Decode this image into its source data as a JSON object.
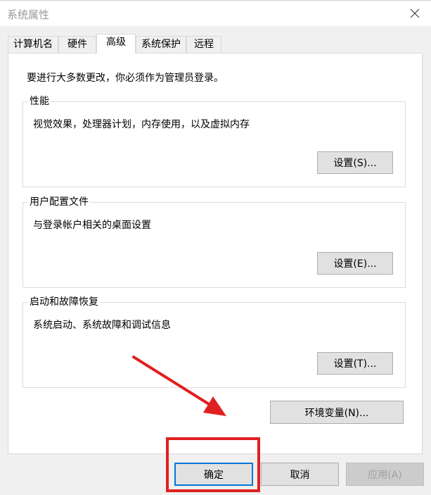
{
  "window": {
    "title": "系统属性"
  },
  "tabs": [
    {
      "label": "计算机名",
      "active": false
    },
    {
      "label": "硬件",
      "active": false
    },
    {
      "label": "高级",
      "active": true
    },
    {
      "label": "系统保护",
      "active": false
    },
    {
      "label": "远程",
      "active": false
    }
  ],
  "panel": {
    "intro": "要进行大多数更改，你必须作为管理员登录。",
    "groups": [
      {
        "title": "性能",
        "desc": "视觉效果，处理器计划，内存使用，以及虚拟内存",
        "button": "设置(S)..."
      },
      {
        "title": "用户配置文件",
        "desc": "与登录帐户相关的桌面设置",
        "button": "设置(E)..."
      },
      {
        "title": "启动和故障恢复",
        "desc": "系统启动、系统故障和调试信息",
        "button": "设置(T)..."
      }
    ],
    "env_button": "环境变量(N)..."
  },
  "footer": {
    "ok": "确定",
    "cancel": "取消",
    "apply": "应用(A)"
  },
  "icons": {
    "close": "close-icon"
  },
  "colors": {
    "annotation": "#e02020",
    "focus_border": "#0078d7"
  }
}
